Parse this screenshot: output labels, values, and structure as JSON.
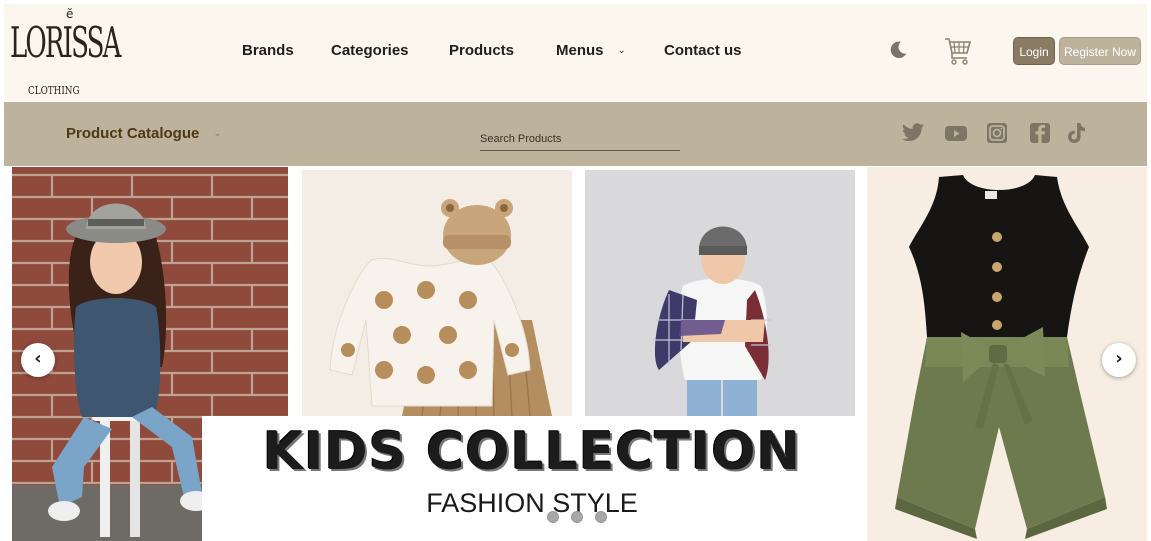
{
  "brand": {
    "name": "LORISSA",
    "tagline": "CLOTHING"
  },
  "nav": {
    "brands": "Brands",
    "categories": "Categories",
    "products": "Products",
    "menus": "Menus",
    "contact": "Contact us"
  },
  "header_icons": [
    "moon-icon",
    "cart-icon"
  ],
  "auth": {
    "login": "Login",
    "register": "Register Now"
  },
  "catalogue": {
    "label": "Product Catalogue"
  },
  "search": {
    "placeholder": "Search Products"
  },
  "social": [
    "twitter-icon",
    "youtube-icon",
    "instagram-icon",
    "facebook-icon",
    "tiktok-icon"
  ],
  "hero": {
    "title": "KIDS COLLECTION",
    "subtitle": "FASHION STYLE",
    "slide_count": 3,
    "active_slide": 1
  },
  "colors": {
    "header_bg": "#fbf7ee",
    "bar_bg": "#bdb29b",
    "catalogue_text": "#4a3a16",
    "login_bg": "#8a7c64",
    "register_bg": "#bdb29c"
  }
}
